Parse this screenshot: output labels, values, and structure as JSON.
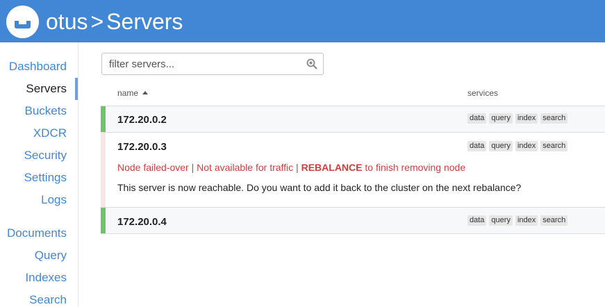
{
  "header": {
    "logo_icon": "couchbase-logo-icon",
    "cluster_name": "otus",
    "separator": ">",
    "page_title": "Servers",
    "bg_color": "#4287d6"
  },
  "sidebar": {
    "items": [
      {
        "label": "Dashboard",
        "active": false
      },
      {
        "label": "Servers",
        "active": true
      },
      {
        "label": "Buckets",
        "active": false
      },
      {
        "label": "XDCR",
        "active": false
      },
      {
        "label": "Security",
        "active": false
      },
      {
        "label": "Settings",
        "active": false
      },
      {
        "label": "Logs",
        "active": false
      },
      {
        "label": "Documents",
        "active": false
      },
      {
        "label": "Query",
        "active": false
      },
      {
        "label": "Indexes",
        "active": false
      },
      {
        "label": "Search",
        "active": false
      }
    ],
    "link_color": "#4287d6"
  },
  "filter": {
    "placeholder": "filter servers...",
    "value": "",
    "icon": "search-icon"
  },
  "table": {
    "columns": {
      "name": "name",
      "services": "services"
    },
    "sort_icon": "sort-ascending-icon",
    "rows": [
      {
        "ip": "172.20.0.2",
        "status": "healthy",
        "services": [
          "data",
          "query",
          "index",
          "search"
        ]
      },
      {
        "ip": "172.20.0.3",
        "status": "failed-over",
        "services": [
          "data",
          "query",
          "index",
          "search"
        ],
        "warning_prefix": "Node failed-over | Not available for traffic | ",
        "warning_action": "REBALANCE",
        "warning_suffix": " to finish removing node",
        "message": "This server is now reachable. Do you want to add it back to the cluster on the next rebalance?"
      },
      {
        "ip": "172.20.0.4",
        "status": "healthy",
        "services": [
          "data",
          "query",
          "index",
          "search"
        ]
      }
    ]
  },
  "colors": {
    "healthy": "#6ec36c",
    "failed": "#d23c3c"
  }
}
